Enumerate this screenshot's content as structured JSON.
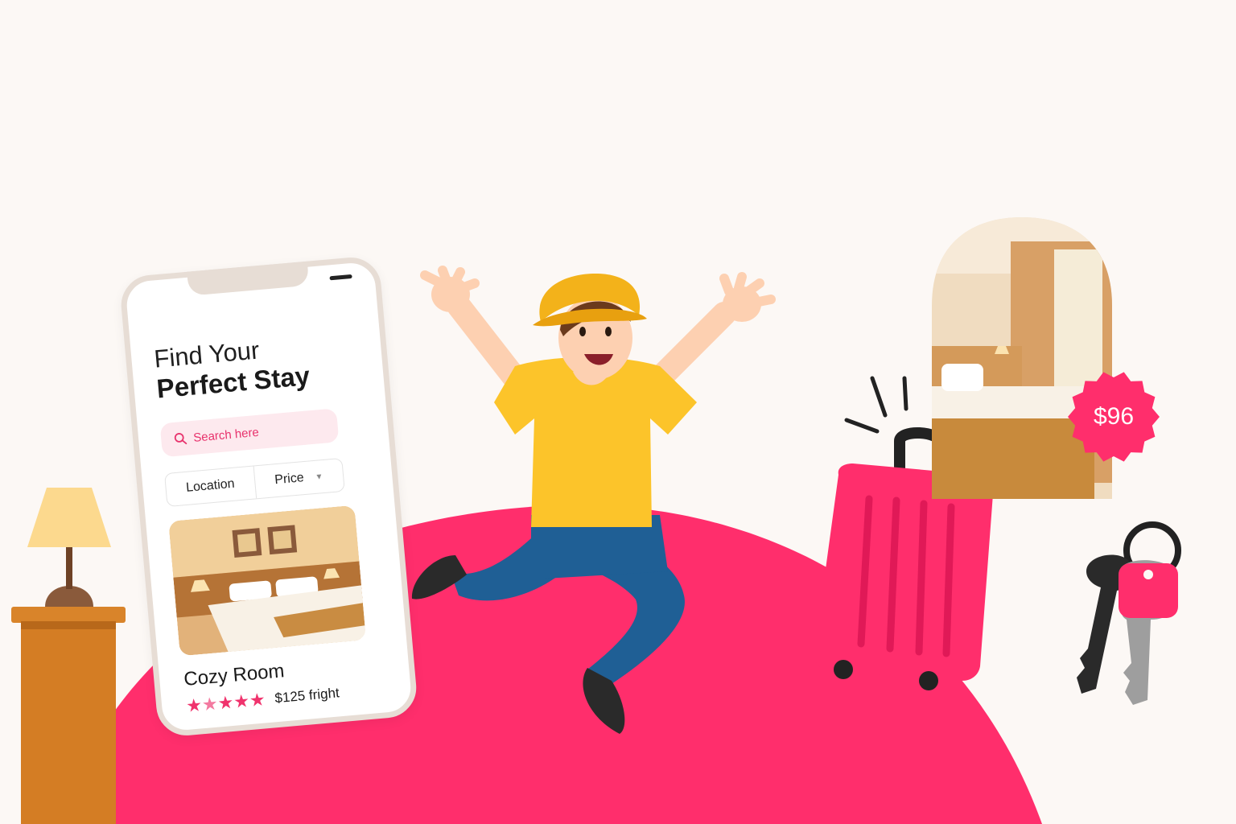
{
  "app": {
    "title_line1": "Find Your",
    "title_line2": "Perfect Stay"
  },
  "search": {
    "placeholder": "Search here"
  },
  "filters": {
    "location_label": "Location",
    "price_label": "Price"
  },
  "listing": {
    "name": "Cozy Room",
    "rating": 5,
    "price_text": "$125 fright"
  },
  "badge": {
    "price": "$96"
  },
  "colors": {
    "accent": "#ff2e6c",
    "background": "#fcf8f5",
    "shirt": "#fcc42a",
    "pants": "#1f5f95"
  },
  "icons": {
    "search": "search-icon",
    "dropdown": "chevron-down-icon",
    "star": "star-icon"
  }
}
